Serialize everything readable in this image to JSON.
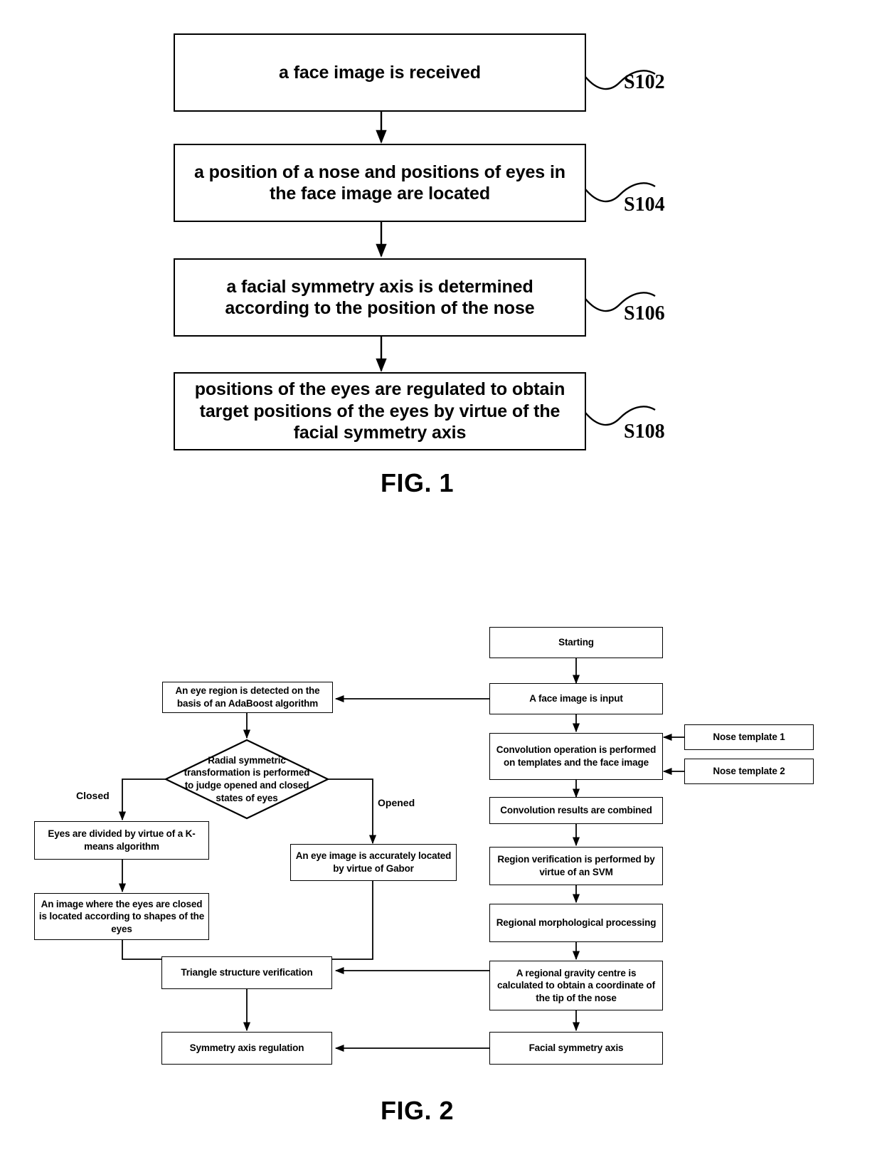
{
  "figure1": {
    "caption": "FIG. 1",
    "steps": [
      {
        "text": "a face image is received",
        "label": "S102"
      },
      {
        "text": "a position of a nose and positions of eyes in the face image are located",
        "label": "S104"
      },
      {
        "text": "a facial symmetry axis is determined according to the position of the nose",
        "label": "S106"
      },
      {
        "text": "positions of the eyes are regulated to obtain target positions of the eyes by virtue of the facial symmetry axis",
        "label": "S108"
      }
    ]
  },
  "figure2": {
    "caption": "FIG. 2",
    "nodes": {
      "starting": "Starting",
      "face_image_input": "A face image is input",
      "convolution_operation": "Convolution operation is performed on templates and the face image",
      "nose_template_1": "Nose template 1",
      "nose_template_2": "Nose template 2",
      "convolution_results": "Convolution results are combined",
      "region_verification": "Region verification is performed by virtue of an SVM",
      "regional_morphological": "Regional morphological processing",
      "gravity_centre": "A regional gravity centre is calculated to obtain a coordinate of the tip of the nose",
      "facial_symmetry_axis": "Facial symmetry axis",
      "eye_region_detect": "An eye region is detected on the basis of an AdaBoost algorithm",
      "radial_symmetric": "Radial symmetric transformation is performed to judge opened and closed states of eyes",
      "kmeans": "Eyes are divided by virtue of a K-means algorithm",
      "closed_eyes_located": "An image where the eyes are closed is located according to shapes of the eyes",
      "gabor": "An eye image is accurately located by virtue of Gabor",
      "triangle_verification": "Triangle structure verification",
      "symmetry_regulation": "Symmetry axis regulation"
    },
    "edge_labels": {
      "closed": "Closed",
      "opened": "Opened"
    }
  }
}
